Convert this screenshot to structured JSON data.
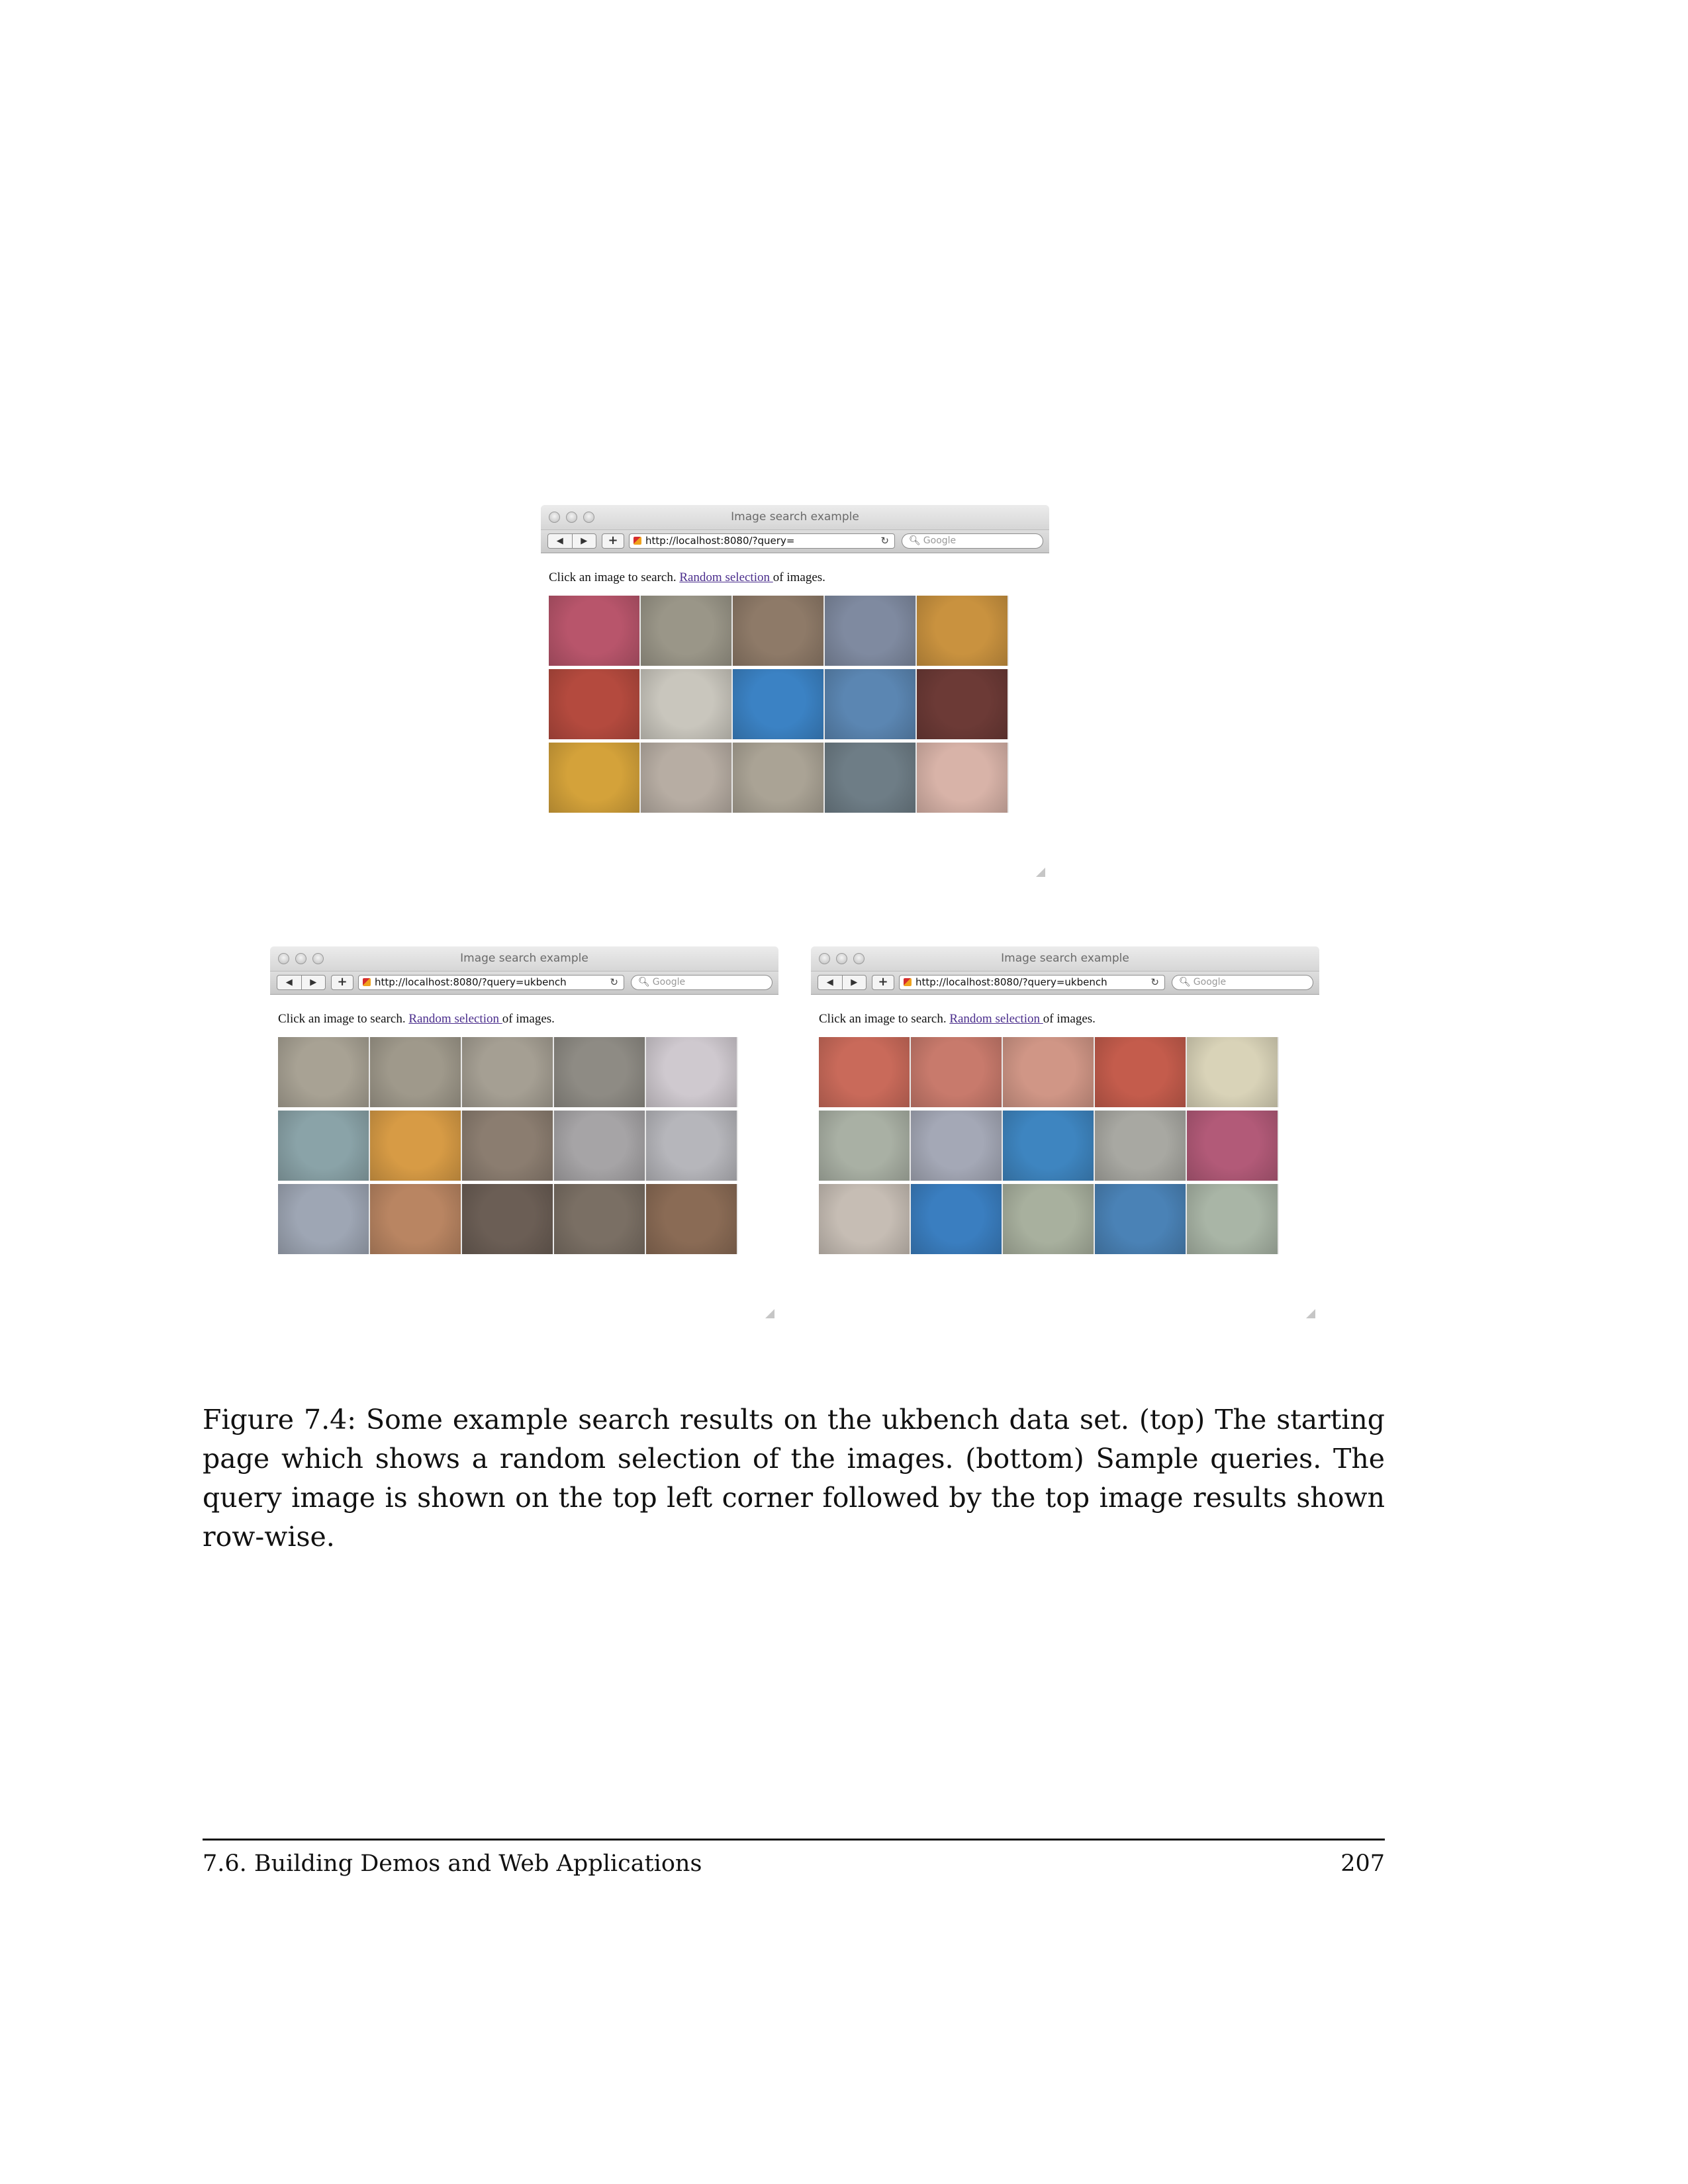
{
  "figure": {
    "windows": [
      {
        "window_title": "Image search example",
        "url": "http://localhost:8080/?query=",
        "search_placeholder": "Google",
        "hint_prefix": "Click an image to search. ",
        "hint_link": "Random selection ",
        "hint_suffix": "of images.",
        "thumbnail_colors": [
          "#b8556b",
          "#9a9688",
          "#8e7a68",
          "#7f8aa0",
          "#c9923f",
          "#b44a3e",
          "#c9c6bd",
          "#3b82c4",
          "#5b86b2",
          "#6c3a36",
          "#d4a23a",
          "#b7ada3",
          "#aaa395",
          "#6e7d86",
          "#d8b3a8"
        ]
      },
      {
        "window_title": "Image search example",
        "url": "http://localhost:8080/?query=ukbench",
        "search_placeholder": "Google",
        "hint_prefix": "Click an image to search. ",
        "hint_link": "Random selection ",
        "hint_suffix": "of images.",
        "thumbnail_colors": [
          "#a8a294",
          "#9f998b",
          "#a59f93",
          "#8e8b84",
          "#cfc9cf",
          "#8aa3a8",
          "#d79b45",
          "#8b7d70",
          "#a6a4a6",
          "#b6b6bb",
          "#9ea6b4",
          "#b98562",
          "#6b5e55",
          "#7a6f64",
          "#8a6b55"
        ]
      },
      {
        "window_title": "Image search example",
        "url": "http://localhost:8080/?query=ukbench",
        "search_placeholder": "Google",
        "hint_prefix": "Click an image to search. ",
        "hint_link": "Random selection ",
        "hint_suffix": "of images.",
        "thumbnail_colors": [
          "#c96a5a",
          "#c87a6c",
          "#d09686",
          "#c45c4c",
          "#d9d3b8",
          "#a9b0a4",
          "#a4a8b6",
          "#3e85c0",
          "#a8a8a2",
          "#b25a78",
          "#c6bdb4",
          "#3a7ec0",
          "#a8b09e",
          "#4a82b6",
          "#a9b5a6"
        ]
      }
    ],
    "caption": "Figure 7.4: Some example search results on the ukbench data set. (top) The starting page which shows a random selection of the images. (bottom) Sample queries. The query image is shown on the top left corner followed by the top image results shown row-wise."
  },
  "footer": {
    "section": "7.6. Building Demos and Web Applications",
    "page_number": "207"
  }
}
